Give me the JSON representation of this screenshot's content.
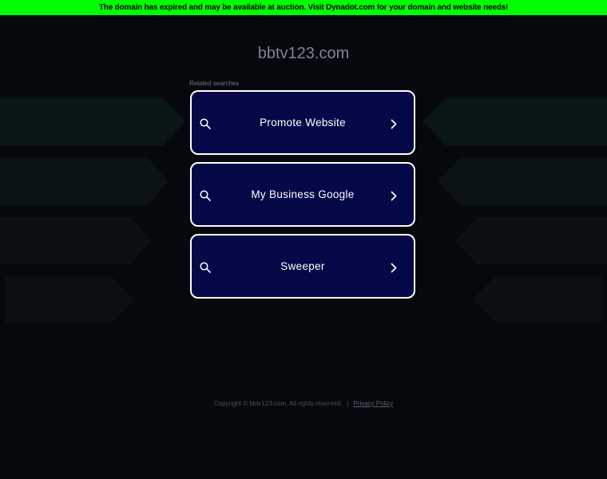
{
  "banner": {
    "text": "The domain has expired and may be available at auction. Visit Dynadot.com for your domain and website needs!"
  },
  "domain": {
    "title": "bbtv123.com"
  },
  "related": {
    "label": "Related searches",
    "items": [
      {
        "label": "Promote Website"
      },
      {
        "label": "My Business Google"
      },
      {
        "label": "Sweeper"
      }
    ]
  },
  "footer": {
    "copyright": "Copyright © bbtv123.com.  All rights reserved.",
    "separator": "|",
    "privacy": "Privacy Policy"
  },
  "colors": {
    "banner": "#00ff00",
    "page_bg": "#05080c",
    "button_bg": "#040846",
    "button_border": "#ffffff"
  },
  "icons": [
    "search-icon",
    "chevron-right-icon"
  ]
}
